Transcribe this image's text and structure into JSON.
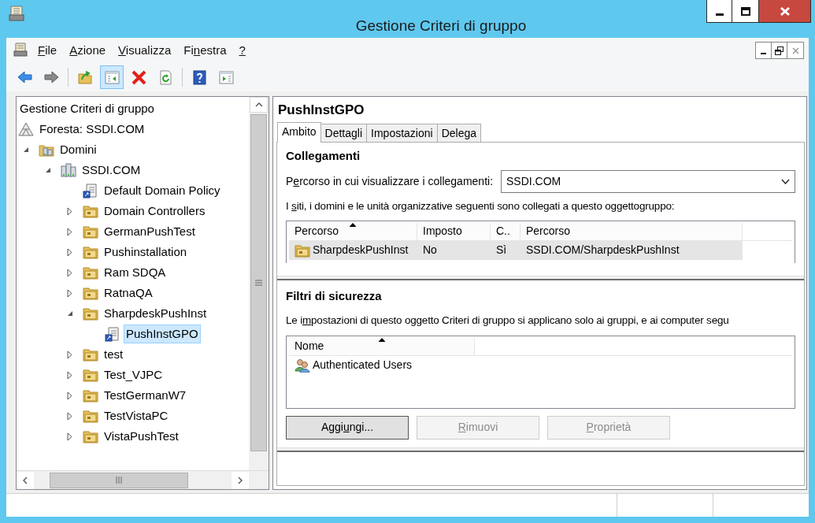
{
  "window": {
    "title": "Gestione Criteri di gruppo"
  },
  "menu": [
    {
      "key": "F",
      "after": "ile"
    },
    {
      "key": "A",
      "after": "zione"
    },
    {
      "key": "V",
      "after": "isualizza"
    },
    {
      "before": "Fi",
      "key": "n",
      "after": "estra"
    },
    {
      "key": "?"
    }
  ],
  "toolbar_groups": [
    [
      {
        "kind": "back",
        "selected": false
      },
      {
        "kind": "forward",
        "selected": false
      }
    ],
    [
      {
        "kind": "up",
        "selected": false
      },
      {
        "kind": "tree_toggle",
        "selected": true
      },
      {
        "kind": "delete",
        "selected": false
      },
      {
        "kind": "refresh",
        "selected": false
      }
    ],
    [
      {
        "kind": "help",
        "selected": false
      },
      {
        "kind": "action_pane",
        "selected": false
      }
    ]
  ],
  "tree": {
    "heading": "Gestione Criteri di gruppo",
    "items": [
      {
        "label": "Foresta: SSDI.COM",
        "kind": "forest",
        "selected": false,
        "children": [
          {
            "label": "Domini",
            "kind": "domains",
            "expanded": true,
            "selected": false,
            "children": [
              {
                "label": "SSDI.COM",
                "kind": "domain",
                "expanded": true,
                "selected": false,
                "children": [
                  {
                    "label": "Default Domain Policy",
                    "kind": "gpo_link",
                    "selected": false
                  },
                  {
                    "label": "Domain Controllers",
                    "kind": "ou",
                    "expanded": false,
                    "selected": false
                  },
                  {
                    "label": "GermanPushTest",
                    "kind": "ou",
                    "expanded": false,
                    "selected": false
                  },
                  {
                    "label": "Pushinstallation",
                    "kind": "ou",
                    "expanded": false,
                    "selected": false
                  },
                  {
                    "label": "Ram SDQA",
                    "kind": "ou",
                    "expanded": false,
                    "selected": false
                  },
                  {
                    "label": "RatnaQA",
                    "kind": "ou",
                    "expanded": false,
                    "selected": false
                  },
                  {
                    "label": "SharpdeskPushInst",
                    "kind": "ou",
                    "expanded": true,
                    "selected": false,
                    "children": [
                      {
                        "label": "PushInstGPO",
                        "kind": "gpo_link",
                        "selected": true
                      }
                    ]
                  },
                  {
                    "label": "test",
                    "kind": "ou",
                    "expanded": false,
                    "selected": false
                  },
                  {
                    "label": "Test_VJPC",
                    "kind": "ou",
                    "expanded": false,
                    "selected": false
                  },
                  {
                    "label": "TestGermanW7",
                    "kind": "ou",
                    "expanded": false,
                    "selected": false
                  },
                  {
                    "label": "TestVistaPC",
                    "kind": "ou",
                    "expanded": false,
                    "selected": false
                  },
                  {
                    "label": "VistaPushTest",
                    "kind": "ou",
                    "expanded": false,
                    "selected": false
                  }
                ]
              }
            ]
          }
        ]
      }
    ]
  },
  "details": {
    "heading": "PushInstGPO",
    "tabs": [
      {
        "label": "Ambito",
        "selected": true
      },
      {
        "label": "Dettagli",
        "selected": false
      },
      {
        "label": "Impostazioni",
        "selected": false
      },
      {
        "label": "Delega",
        "selected": false
      }
    ],
    "links": {
      "title": "Collegamenti",
      "location_label": {
        "before": "P",
        "key": "e",
        "after": "rcorso in cui visualizzare i collegamenti:"
      },
      "location_value": "SSDI.COM",
      "description": {
        "before": "I ",
        "key": "s",
        "after": "iti, i domini e le unità organizzative seguenti sono collegati a questo oggettogruppo:"
      },
      "columns": [
        {
          "label": "Percorso",
          "sorted": true
        },
        {
          "label": "Imposto",
          "sorted": false
        },
        {
          "label": "C..",
          "sorted": false
        },
        {
          "label": "Percorso",
          "sorted": false
        }
      ],
      "rows": [
        {
          "cells": [
            "SharpdeskPushInst",
            "No",
            "Sì",
            "SSDI.COM/SharpdeskPushInst"
          ],
          "selected": true
        }
      ]
    },
    "security": {
      "title": "Filtri di sicurezza",
      "description": {
        "before": "Le i",
        "key": "m",
        "after": "postazioni di questo oggetto Criteri di gruppo si applicano solo ai gruppi, e ai computer segu"
      },
      "columns": [
        {
          "label": "Nome",
          "sorted": true
        }
      ],
      "rows": [
        {
          "cells": [
            "Authenticated Users"
          ],
          "selected": false
        }
      ],
      "buttons": [
        {
          "before": "Aggi",
          "key": "u",
          "after": "ngi...",
          "disabled": false,
          "focused": true
        },
        {
          "key": "R",
          "after": "imuovi",
          "disabled": true,
          "focused": false
        },
        {
          "key": "P",
          "after": "roprietà",
          "disabled": true,
          "focused": false
        }
      ]
    }
  }
}
